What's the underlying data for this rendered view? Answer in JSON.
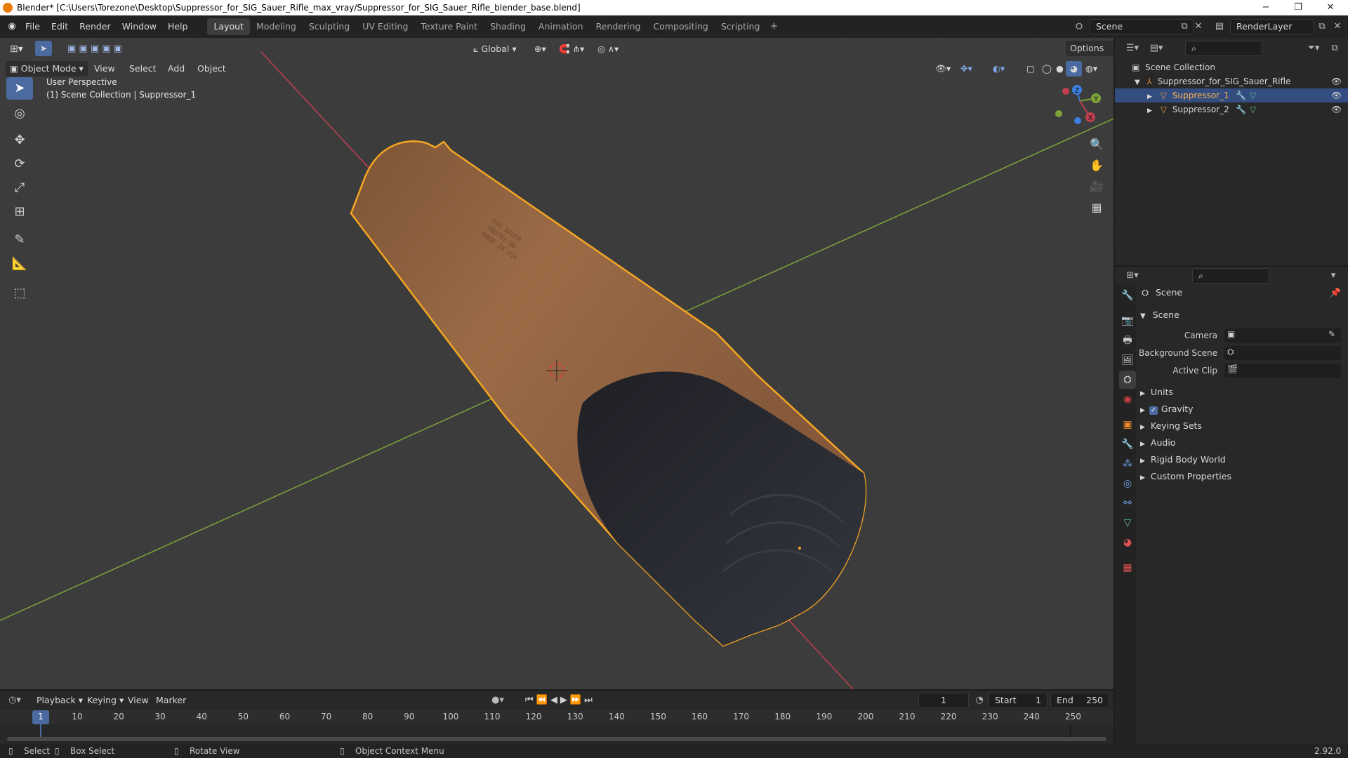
{
  "window": {
    "title": "Blender* [C:\\Users\\Torezone\\Desktop\\Suppressor_for_SIG_Sauer_Rifle_max_vray/Suppressor_for_SIG_Sauer_Rifle_blender_base.blend]",
    "minimize": "−",
    "restore": "❐",
    "close": "✕"
  },
  "menu": [
    "File",
    "Edit",
    "Render",
    "Window",
    "Help"
  ],
  "workspaces": [
    "Layout",
    "Modeling",
    "Sculpting",
    "UV Editing",
    "Texture Paint",
    "Shading",
    "Animation",
    "Rendering",
    "Compositing",
    "Scripting"
  ],
  "active_workspace": "Layout",
  "scene_selector": {
    "label": "Scene"
  },
  "render_layer": {
    "label": "RenderLayer"
  },
  "viewport": {
    "mode": "Object Mode",
    "menus": [
      "View",
      "Select",
      "Add",
      "Object"
    ],
    "transform_orientation": "Global",
    "options_label": "Options",
    "overlay_line1": "User Perspective",
    "overlay_line2": "(1) Scene Collection | Suppressor_1",
    "gizmo": {
      "x": "X",
      "y": "Y",
      "z": "Z"
    },
    "engraving": [
      "SIG SAUER",
      "SRD762-QD",
      "MADE IN USA"
    ]
  },
  "outliner": {
    "root": "Scene Collection",
    "collection": "Suppressor_for_SIG_Sauer_Rifle",
    "items": [
      {
        "name": "Suppressor_1",
        "selected": true
      },
      {
        "name": "Suppressor_2",
        "selected": false
      }
    ]
  },
  "properties": {
    "header": "Scene",
    "panel": "Scene",
    "fields": [
      {
        "label": "Camera"
      },
      {
        "label": "Background Scene"
      },
      {
        "label": "Active Clip"
      }
    ],
    "sections": [
      "Units",
      "Gravity",
      "Keying Sets",
      "Audio",
      "Rigid Body World",
      "Custom Properties"
    ],
    "gravity_checked": true
  },
  "timeline": {
    "menus": [
      "Playback",
      "Keying",
      "View",
      "Marker"
    ],
    "current_frame": "1",
    "start_label": "Start",
    "start": "1",
    "end_label": "End",
    "end": "250",
    "ticks": [
      "1",
      "10",
      "20",
      "30",
      "40",
      "50",
      "60",
      "70",
      "80",
      "90",
      "100",
      "110",
      "120",
      "130",
      "140",
      "150",
      "160",
      "170",
      "180",
      "190",
      "200",
      "210",
      "220",
      "230",
      "240",
      "250"
    ]
  },
  "status": {
    "select": "Select",
    "box_select": "Box Select",
    "rotate_view": "Rotate View",
    "context_menu": "Object Context Menu",
    "version": "2.92.0"
  },
  "colors": {
    "selection_outline": "#f5a623",
    "suppressor_tan": "#9a6a45",
    "suppressor_cap": "#2a2c33",
    "active_blue": "#4b6aa0",
    "x_axis": "#c0404f",
    "y_axis": "#7ea23a"
  }
}
